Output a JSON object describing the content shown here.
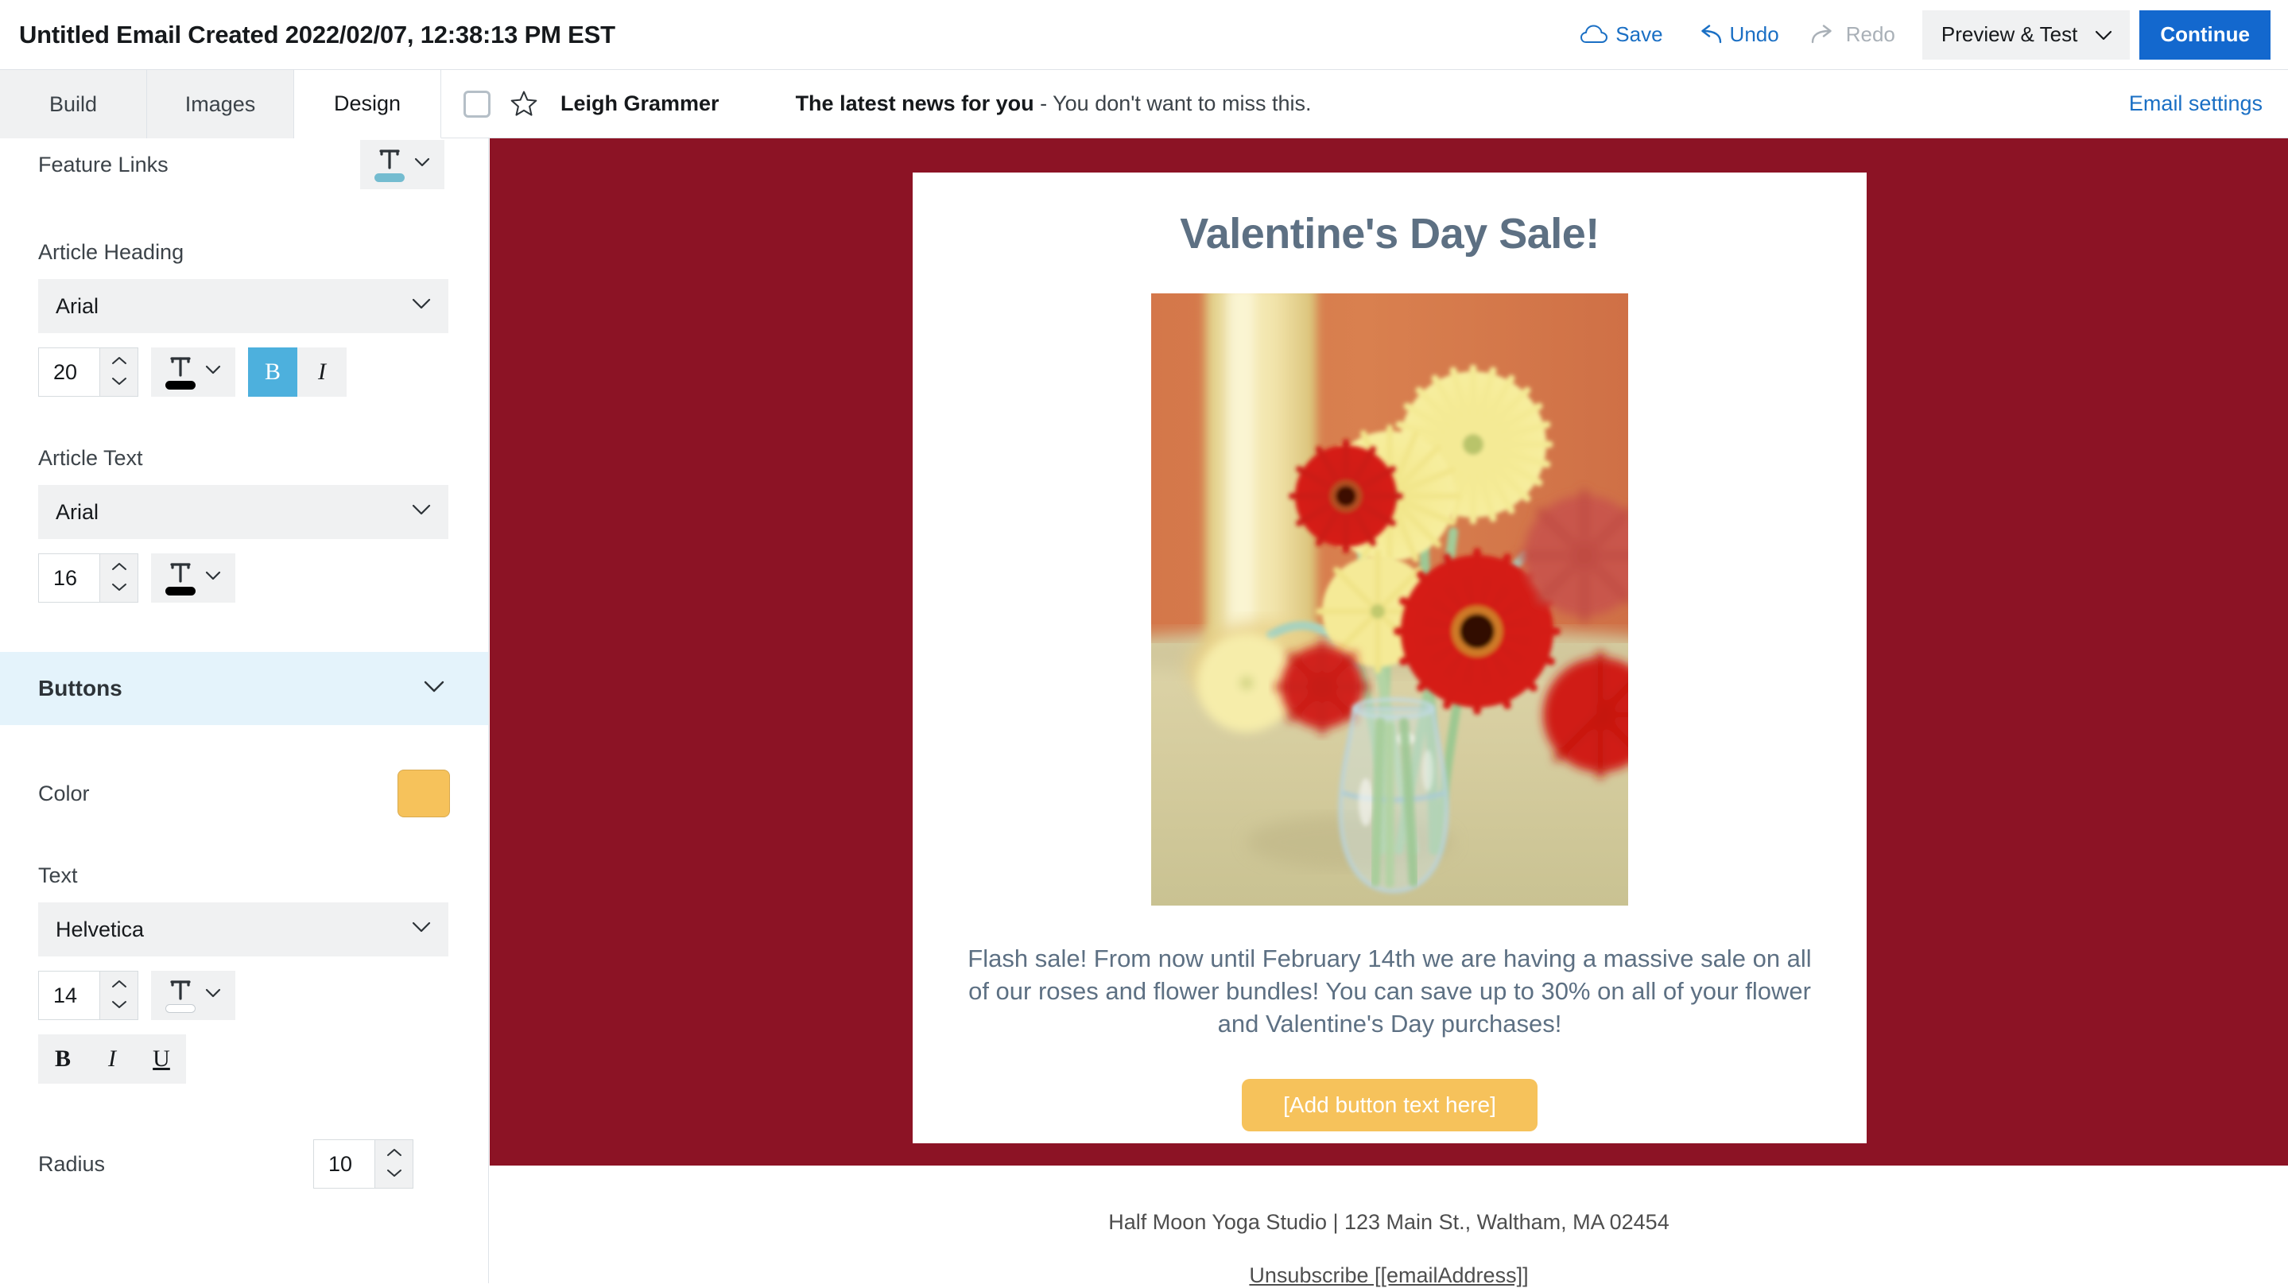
{
  "topbar": {
    "doc_title": "Untitled Email Created 2022/02/07, 12:38:13 PM EST",
    "save_label": "Save",
    "undo_label": "Undo",
    "redo_label": "Redo",
    "preview_label": "Preview & Test",
    "continue_label": "Continue",
    "accent_blue": "#1a6fc4",
    "continue_bg": "#1368ce",
    "disabled_color": "#a9b0b7"
  },
  "tabs": [
    {
      "label": "Build",
      "active": false
    },
    {
      "label": "Images",
      "active": false
    },
    {
      "label": "Design",
      "active": true
    }
  ],
  "mail_header": {
    "sender": "Leigh Grammer",
    "subject_bold": "The latest news for you",
    "subject_rest": " - You don't want to miss this.",
    "settings_label": "Email settings"
  },
  "sidebar": {
    "feature_links": {
      "label": "Feature Links",
      "color_value": "#74bcd0"
    },
    "article_heading": {
      "label": "Article Heading",
      "font": "Arial",
      "size": "20",
      "color_value": "#000000",
      "bold_on": true,
      "italic_on": false,
      "bold_label": "B",
      "italic_label": "I"
    },
    "article_text": {
      "label": "Article Text",
      "font": "Arial",
      "size": "16",
      "color_value": "#000000"
    },
    "buttons_section": {
      "title": "Buttons",
      "color_label": "Color",
      "color_value": "#f6c25b",
      "text_label": "Text",
      "text_font": "Helvetica",
      "text_size": "14",
      "text_color_value": "#ffffff",
      "bold_label": "B",
      "italic_label": "I",
      "underline_label": "U",
      "radius_label": "Radius",
      "radius_value": "10"
    }
  },
  "email": {
    "canvas_bg": "#8c1325",
    "heading": "Valentine's Day Sale!",
    "heading_color": "#5d7083",
    "body": "Flash sale! From now until February 14th we are having a massive sale on all of our roses and flower bundles! You can save up to 30% on all of your flower and Valentine's Day purchases!",
    "button_label": "[Add button text here]",
    "button_bg": "#f6c25b",
    "image_alt": "red and yellow gerbera daisies in a glass vase"
  },
  "footer": {
    "address": "Half Moon Yoga Studio | 123 Main St., Waltham, MA 02454",
    "unsubscribe": "Unsubscribe [[emailAddress]]"
  }
}
